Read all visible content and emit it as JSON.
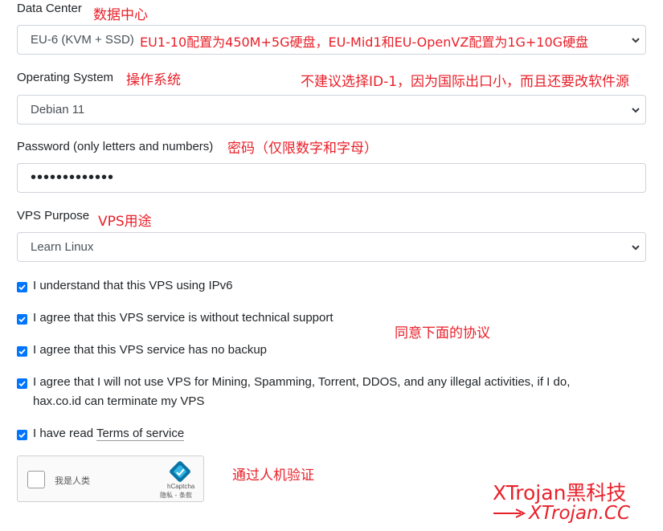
{
  "data_center": {
    "label": "Data Center",
    "note": "数据中心",
    "value": "EU-6 (KVM + SSD)",
    "value_note": "EU1-10配置为450M+5G硬盘，EU-Mid1和EU-OpenVZ配置为1G+10G硬盘"
  },
  "os": {
    "label": "Operating System",
    "note": "操作系统",
    "side_note": "不建议选择ID-1，因为国际出口小，而且还要改软件源",
    "value": "Debian 11"
  },
  "password": {
    "label": "Password (only letters and numbers)",
    "note": "密码（仅限数字和字母）",
    "value": "•••••••••••••"
  },
  "purpose": {
    "label": "VPS Purpose",
    "note": "VPS用途",
    "value": "Learn Linux"
  },
  "agreements": {
    "note": "同意下面的协议",
    "items": [
      "I understand that this VPS using IPv6",
      "I agree that this VPS service is without technical support",
      "I agree that this VPS service has no backup",
      "I agree that I will not use VPS for Mining, Spamming, Torrent, DDOS, and any illegal activities, if I do, hax.co.id can terminate my VPS"
    ],
    "terms_prefix": "I have read",
    "terms_link": "Terms of service"
  },
  "captcha": {
    "label": "我是人类",
    "brand": "hCaptcha",
    "links": "隐私 - 条款",
    "note": "通过人机验证"
  },
  "watermark": {
    "line1": "XTrojan黑科技",
    "line2": "XTrojan.CC"
  },
  "colors": {
    "accent": "#0075ff",
    "annotation": "#e8202a"
  }
}
